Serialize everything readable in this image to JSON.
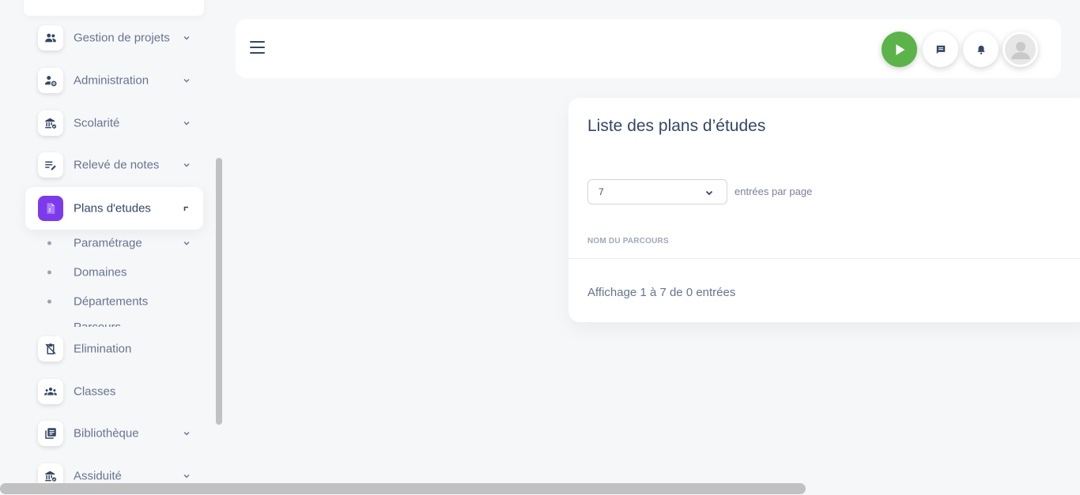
{
  "sidebar": {
    "items": [
      {
        "label": "Gestion de projets",
        "icon": "users-icon"
      },
      {
        "label": "Administration",
        "icon": "user-cog-icon"
      },
      {
        "label": "Scolarité",
        "icon": "institution-icon"
      },
      {
        "label": "Relevé de notes",
        "icon": "edit-list-icon"
      },
      {
        "label": "Plans d'etudes",
        "icon": "document-icon",
        "active": true
      },
      {
        "label": "Elimination",
        "icon": "clipboard-off-icon"
      },
      {
        "label": "Classes",
        "icon": "group-icon"
      },
      {
        "label": "Bibliothèque",
        "icon": "library-icon"
      },
      {
        "label": "Assiduité",
        "icon": "institution-check-icon"
      }
    ],
    "subitems": [
      {
        "label": "Paramétrage"
      },
      {
        "label": "Domaines"
      },
      {
        "label": "Départements"
      },
      {
        "label": "Parcours"
      }
    ]
  },
  "main": {
    "card": {
      "title": "Liste des plans d’études",
      "entries_value": "7",
      "entries_label": "entrées par page",
      "column_header": "NOM DU PARCOURS",
      "info": "Affichage 1 à 7 de 0 entrées"
    }
  },
  "colors": {
    "accent": "#7c3aed",
    "play": "#5bb349",
    "text": "#344767",
    "muted": "#67748e",
    "background": "#f6f7f9"
  }
}
